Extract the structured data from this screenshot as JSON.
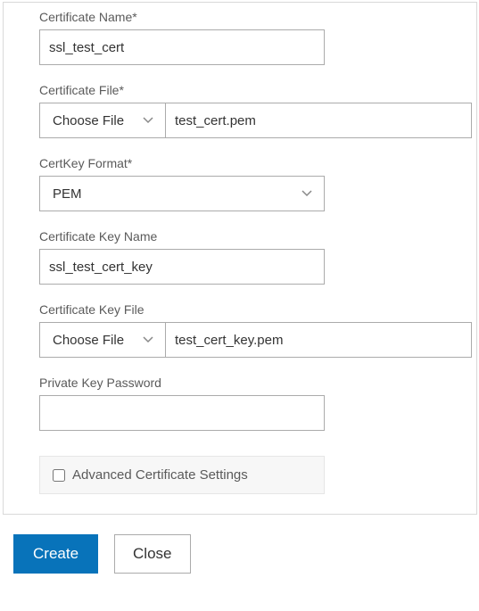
{
  "form": {
    "cert_name": {
      "label": "Certificate Name*",
      "value": "ssl_test_cert"
    },
    "cert_file": {
      "label": "Certificate File*",
      "choose_label": "Choose File",
      "file_name": "test_cert.pem"
    },
    "certkey_format": {
      "label": "CertKey Format*",
      "selected": "PEM"
    },
    "cert_key_name": {
      "label": "Certificate Key Name",
      "value": "ssl_test_cert_key"
    },
    "cert_key_file": {
      "label": "Certificate Key File",
      "choose_label": "Choose File",
      "file_name": "test_cert_key.pem"
    },
    "private_key_password": {
      "label": "Private Key Password",
      "value": ""
    },
    "advanced_settings_label": "Advanced Certificate Settings"
  },
  "buttons": {
    "create": "Create",
    "close": "Close"
  }
}
